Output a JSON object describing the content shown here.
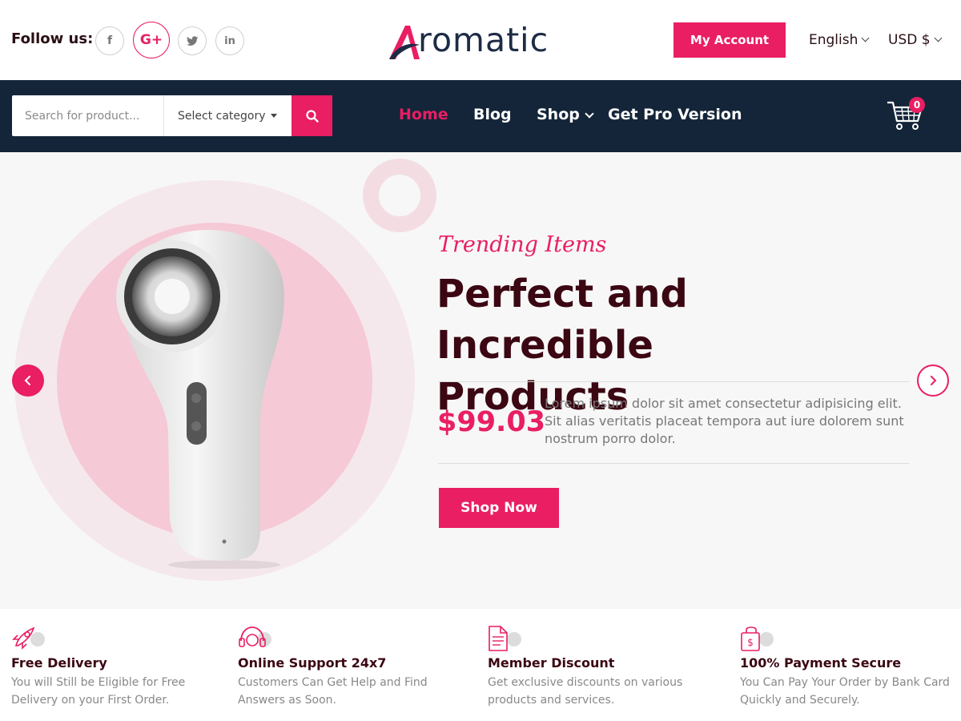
{
  "header": {
    "follow_label": "Follow us:",
    "social": [
      {
        "icon": "facebook-icon",
        "glyph": "f"
      },
      {
        "icon": "google-plus-icon",
        "glyph": "G+"
      },
      {
        "icon": "twitter-icon",
        "glyph": "t"
      },
      {
        "icon": "linkedin-icon",
        "glyph": "in"
      }
    ],
    "logo_text": "romatic",
    "account_label": "My Account",
    "language": "English",
    "currency": "USD $"
  },
  "nav": {
    "search_placeholder": "Search for product...",
    "category_label": "Select category",
    "links": [
      {
        "label": "Home",
        "active": true
      },
      {
        "label": "Blog",
        "active": false
      },
      {
        "label": "Shop",
        "active": false
      },
      {
        "label": "Get Pro Version",
        "active": false
      }
    ],
    "cart_count": "0"
  },
  "hero": {
    "tagline": "Trending Items",
    "title_line1": "Perfect and Incredible",
    "title_line2": "Products",
    "price": "$99.03",
    "description": "Lorem ipsum dolor sit amet consectetur adipisicing elit. Sit alias veritatis placeat tempora aut iure dolorem sunt nostrum porro dolor.",
    "cta_label": "Shop Now"
  },
  "features": [
    {
      "icon": "rocket-icon",
      "title": "Free Delivery",
      "text": "You will Still be Eligible for Free Delivery on your First Order."
    },
    {
      "icon": "headset-icon",
      "title": "Online Support 24x7",
      "text": "Customers Can Get Help and Find Answers as Soon."
    },
    {
      "icon": "document-icon",
      "title": "Member Discount",
      "text": "Get exclusive discounts on various products and services."
    },
    {
      "icon": "secure-bag-icon",
      "title": "100% Payment Secure",
      "text": "You Can Pay Your Order by Bank Card Quickly and Securely."
    }
  ],
  "colors": {
    "accent": "#e91e63",
    "navbar": "#142539",
    "heading": "#3b0712"
  }
}
